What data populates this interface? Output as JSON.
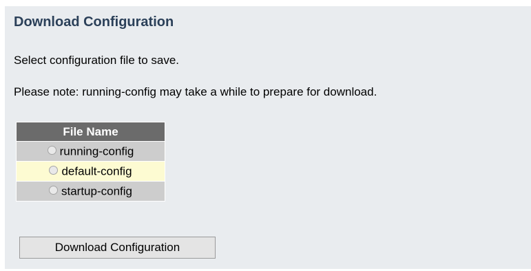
{
  "header": {
    "title": "Download Configuration"
  },
  "instructions": {
    "select_text": "Select configuration file to save.",
    "note_text": "Please note: running-config may take a while to prepare for download."
  },
  "file_table": {
    "column_header": "File Name",
    "rows": [
      {
        "label": "running-config",
        "selected": false
      },
      {
        "label": "default-config",
        "selected": false
      },
      {
        "label": "startup-config",
        "selected": false
      }
    ]
  },
  "actions": {
    "download_label": "Download Configuration"
  },
  "colors": {
    "title": "#2b4059",
    "panel_background": "#e9ecef",
    "header_background": "#6b6b6b",
    "row_background": "#cdcdcd",
    "row_highlight": "#fdfbd2"
  }
}
